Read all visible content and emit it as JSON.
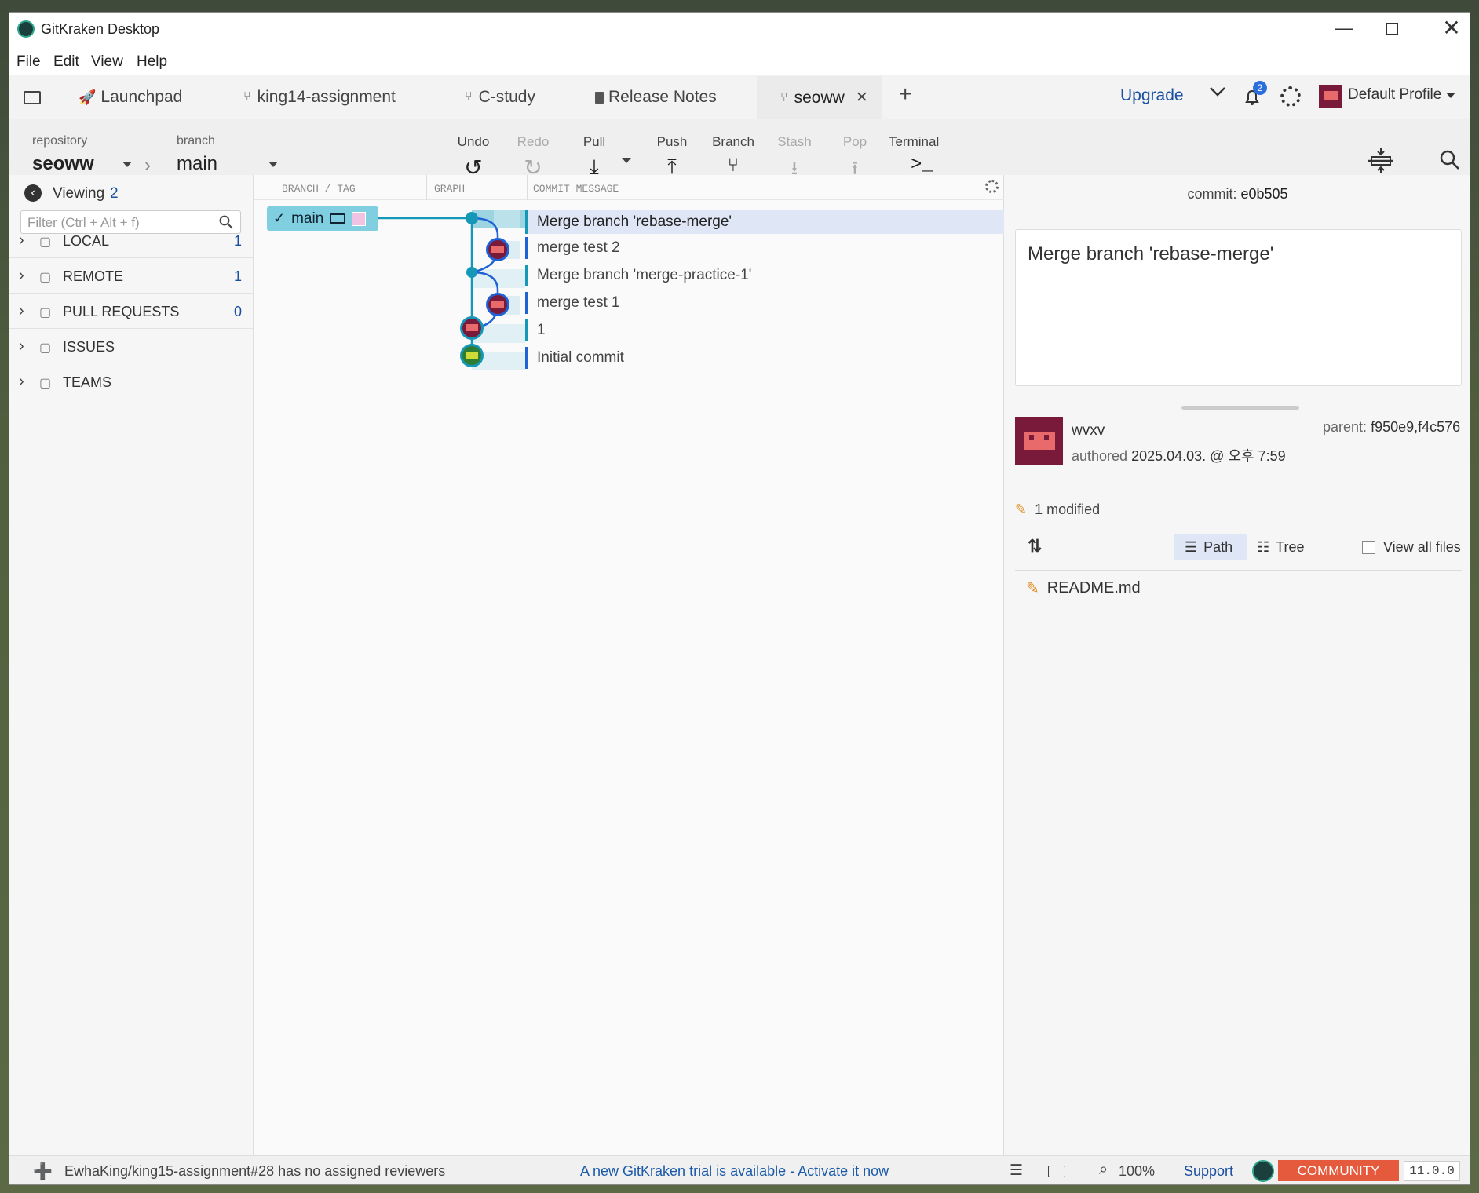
{
  "window": {
    "title": "GitKraken Desktop"
  },
  "menu": [
    "File",
    "Edit",
    "View",
    "Help"
  ],
  "tabs": [
    {
      "label": "Launchpad",
      "icon": "rocket-icon"
    },
    {
      "label": "king14-assignment",
      "icon": "branch-icon"
    },
    {
      "label": "C-study",
      "icon": "branch-icon"
    },
    {
      "label": "Release Notes",
      "icon": "clipboard-icon"
    },
    {
      "label": "seoww",
      "icon": "branch-icon",
      "active": true
    }
  ],
  "topright": {
    "upgrade": "Upgrade",
    "notif_count": "2",
    "profile": "Default Profile"
  },
  "repo": {
    "repo_label": "repository",
    "repo_name": "seoww",
    "branch_label": "branch",
    "branch_name": "main"
  },
  "toolbar": {
    "undo": "Undo",
    "redo": "Redo",
    "pull": "Pull",
    "push": "Push",
    "branch": "Branch",
    "stash": "Stash",
    "pop": "Pop",
    "terminal": "Terminal"
  },
  "sidebar": {
    "viewing_label": "Viewing",
    "viewing_count": "2",
    "filter_placeholder": "Filter (Ctrl + Alt + f)",
    "sections": [
      {
        "label": "LOCAL",
        "count": "1",
        "icon": "laptop-icon"
      },
      {
        "label": "REMOTE",
        "count": "1",
        "icon": "cloud-icon"
      },
      {
        "label": "PULL REQUESTS",
        "count": "0",
        "icon": "pull-request-icon"
      },
      {
        "label": "ISSUES",
        "count": "",
        "icon": "list-icon"
      },
      {
        "label": "TEAMS",
        "count": "",
        "icon": "team-icon"
      }
    ]
  },
  "graph": {
    "headers": {
      "branch": "BRANCH / TAG",
      "graph": "GRAPH",
      "message": "COMMIT MESSAGE"
    },
    "branch_label": "main",
    "commits": [
      "Merge branch 'rebase-merge'",
      "merge test 2",
      "Merge branch 'merge-practice-1'",
      "merge test 1",
      "1",
      "Initial commit"
    ]
  },
  "detail": {
    "commit_label": "commit:",
    "commit_sha": "e0b505",
    "message": "Merge branch 'rebase-merge'",
    "author": "wvxv",
    "authored_label": "authored",
    "date": "2025.04.03. @ 오후 7:59",
    "parent_label": "parent:",
    "parents": "f950e9,f4c576",
    "modified": "1 modified",
    "path": "Path",
    "tree": "Tree",
    "view_all": "View all files",
    "file": "README.md"
  },
  "status": {
    "message": "EwhaKing/king15-assignment#28 has no assigned reviewers",
    "trial": "A new GitKraken trial is available - Activate it now",
    "zoom": "100%",
    "support": "Support",
    "community": "COMMUNITY",
    "version": "11.0.0"
  },
  "colors": {
    "accent": "#1a4fa0",
    "graph_teal": "#1597b8",
    "graph_blue": "#1f62d6",
    "selected_row": "#dfe7f6",
    "community": "#e55a3c"
  }
}
